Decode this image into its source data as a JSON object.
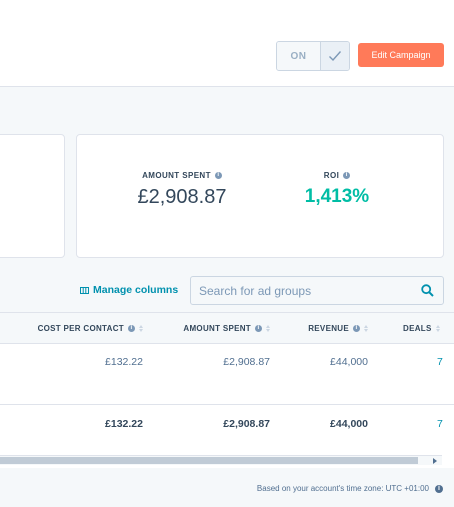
{
  "header": {
    "toggle_label": "ON",
    "edit_button": "Edit Campaign"
  },
  "summary": {
    "amount_spent": {
      "label": "AMOUNT SPENT",
      "value": "£2,908.87"
    },
    "roi": {
      "label": "ROI",
      "value": "1,413%"
    }
  },
  "toolbar": {
    "manage_columns": "Manage columns",
    "search_placeholder": "Search for ad groups"
  },
  "table": {
    "columns": [
      "COST PER CONTACT",
      "AMOUNT SPENT",
      "REVENUE",
      "DEALS"
    ],
    "rows": [
      [
        "£132.22",
        "£2,908.87",
        "£44,000",
        "7"
      ]
    ],
    "totals": [
      "£132.22",
      "£2,908.87",
      "£44,000",
      "7"
    ]
  },
  "footer": {
    "timezone_note": "Based on your account's time zone: UTC +01:00"
  },
  "colors": {
    "accent": "#ff7a59",
    "link": "#0091ae",
    "positive": "#00bda5"
  }
}
